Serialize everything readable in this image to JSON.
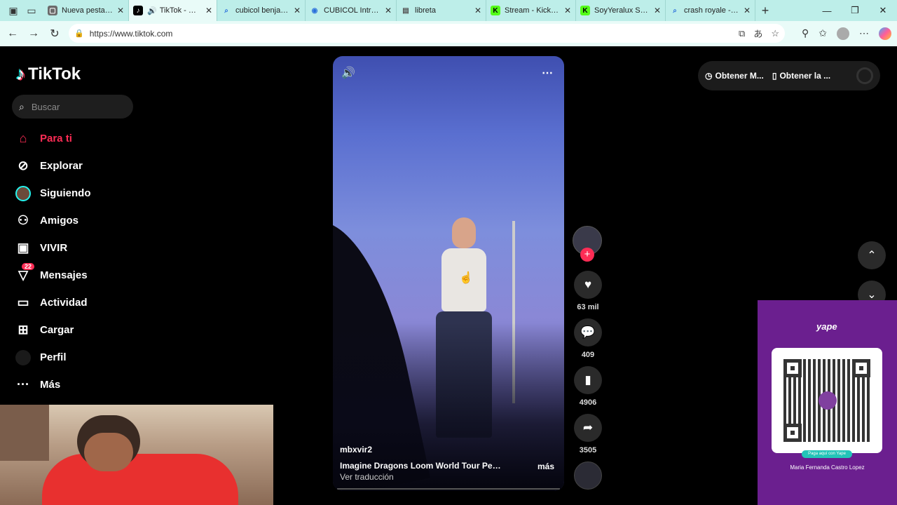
{
  "browser": {
    "tabs": [
      {
        "label": "Nueva pestaña",
        "icon": "page-icon",
        "active": false,
        "width": 122
      },
      {
        "label": "TikTok - Make Your Day",
        "icon": "tiktok-icon",
        "active": true,
        "width": 126,
        "audio": true
      },
      {
        "label": "cubicol benjamin",
        "icon": "search-icon",
        "active": false,
        "width": 126
      },
      {
        "label": "CUBICOL Intranet",
        "icon": "cubicol-icon",
        "active": false,
        "width": 130
      },
      {
        "label": "libreta",
        "icon": "doc-icon",
        "active": false,
        "width": 128
      },
      {
        "label": "Stream - Kick Dashboard",
        "icon": "kick-icon",
        "active": false,
        "width": 128
      },
      {
        "label": "SoyYeralux Stream",
        "icon": "kick-icon",
        "active": false,
        "width": 128
      },
      {
        "label": "crash royale - Búsqueda",
        "icon": "search-icon",
        "active": false,
        "width": 128
      }
    ],
    "url": "https://www.tiktok.com"
  },
  "tiktok": {
    "brand": "TikTok",
    "search_placeholder": "Buscar",
    "nav": [
      {
        "label": "Para ti",
        "icon": "home-icon",
        "active": true
      },
      {
        "label": "Explorar",
        "icon": "compass-icon"
      },
      {
        "label": "Siguiendo",
        "icon": "following-avatar-icon"
      },
      {
        "label": "Amigos",
        "icon": "friends-icon"
      },
      {
        "label": "VIVIR",
        "icon": "live-icon"
      },
      {
        "label": "Mensajes",
        "icon": "messages-icon",
        "badge": "22"
      },
      {
        "label": "Actividad",
        "icon": "activity-icon"
      },
      {
        "label": "Cargar",
        "icon": "upload-icon"
      },
      {
        "label": "Perfil",
        "icon": "profile-icon"
      },
      {
        "label": "Más",
        "icon": "more-icon"
      }
    ],
    "video": {
      "username": "mbxvir2",
      "description": "Imagine Dragons  Loom World Tour Perú ...",
      "more": "más",
      "translate": "Ver traducción"
    },
    "actions": {
      "likes": "63 mil",
      "comments": "409",
      "saves": "4906",
      "shares": "3505"
    },
    "topbar": {
      "get_coins": "Obtener M...",
      "get_app": "Obtener la ..."
    }
  },
  "yape": {
    "brand": "yape",
    "pill": "Paga aquí con Yape",
    "name": "Maria Fernanda Castro Lopez"
  }
}
